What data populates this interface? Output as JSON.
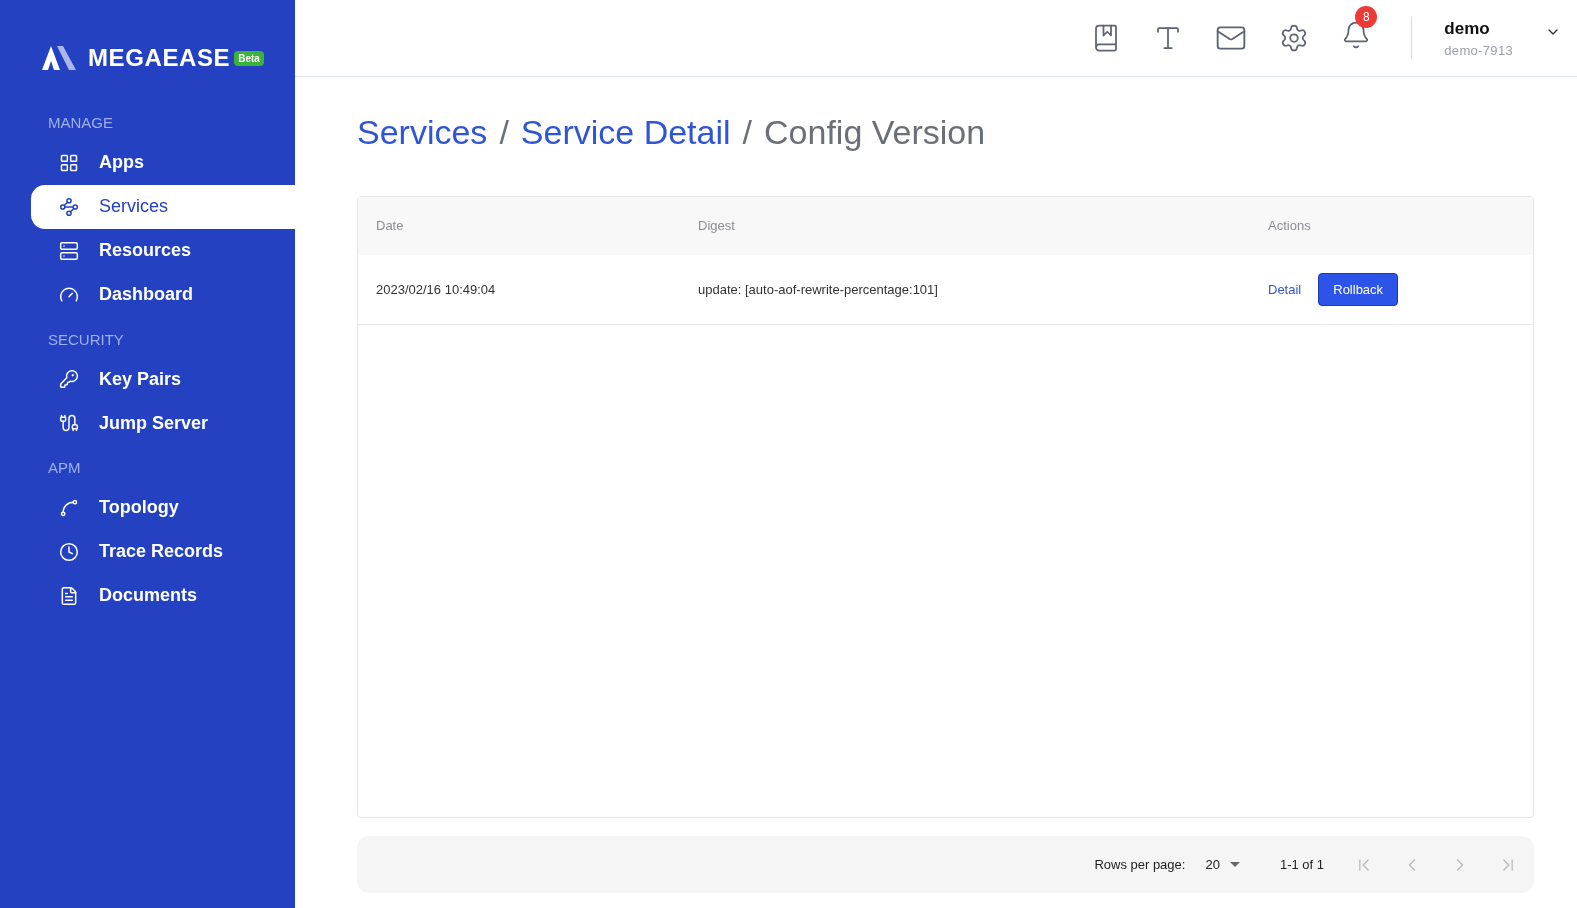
{
  "sidebar": {
    "logo": "MEGAEASE",
    "badge": "Beta",
    "sections": [
      {
        "title": "MANAGE",
        "items": [
          {
            "label": "Apps",
            "selected": false
          },
          {
            "label": "Services",
            "selected": true
          },
          {
            "label": "Resources",
            "selected": false
          },
          {
            "label": "Dashboard",
            "selected": false
          }
        ]
      },
      {
        "title": "SECURITY",
        "items": [
          {
            "label": "Key Pairs",
            "selected": false
          },
          {
            "label": "Jump Server",
            "selected": false
          }
        ]
      },
      {
        "title": "APM",
        "items": [
          {
            "label": "Topology",
            "selected": false
          },
          {
            "label": "Trace Records",
            "selected": false
          },
          {
            "label": "Documents",
            "selected": false
          }
        ]
      }
    ]
  },
  "header": {
    "notification_count": "8",
    "user": {
      "name": "demo",
      "account": "demo-7913"
    }
  },
  "breadcrumb_separator": "/",
  "breadcrumb": [
    {
      "label": "Services",
      "kind": "link"
    },
    {
      "label": "Service Detail",
      "kind": "link"
    },
    {
      "label": "Config Version",
      "kind": "current"
    }
  ],
  "table": {
    "columns": [
      "Date",
      "Digest",
      "Actions"
    ],
    "rows": [
      {
        "date": "2023/02/16 10:49:04",
        "digest": "update: [auto-aof-rewrite-percentage:101]",
        "actions": [
          "Detail",
          "Rollback"
        ]
      }
    ]
  },
  "pagination": {
    "rows_per_page_label": "Rows per page:",
    "rows_per_page": "20",
    "range": "1-1 of 1",
    "first_disabled": true,
    "prev_disabled": true,
    "next_disabled": true,
    "last_disabled": true
  }
}
